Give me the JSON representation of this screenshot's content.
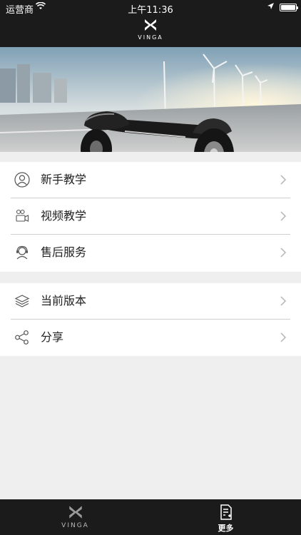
{
  "status_bar": {
    "carrier": "运营商",
    "time": "上午11:36"
  },
  "header": {
    "brand": "VINGA"
  },
  "menu_group_1": [
    {
      "label": "新手教学",
      "icon": "person-icon"
    },
    {
      "label": "视频教学",
      "icon": "video-camera-icon"
    },
    {
      "label": "售后服务",
      "icon": "support-agent-icon"
    }
  ],
  "menu_group_2": [
    {
      "label": "当前版本",
      "icon": "layers-icon"
    },
    {
      "label": "分享",
      "icon": "share-icon"
    }
  ],
  "tab_bar": {
    "home_label": "VINGA",
    "more_label": "更多"
  },
  "colors": {
    "bar": "#1b1b1b",
    "background": "#efefef",
    "separator": "#cfcfcf"
  }
}
